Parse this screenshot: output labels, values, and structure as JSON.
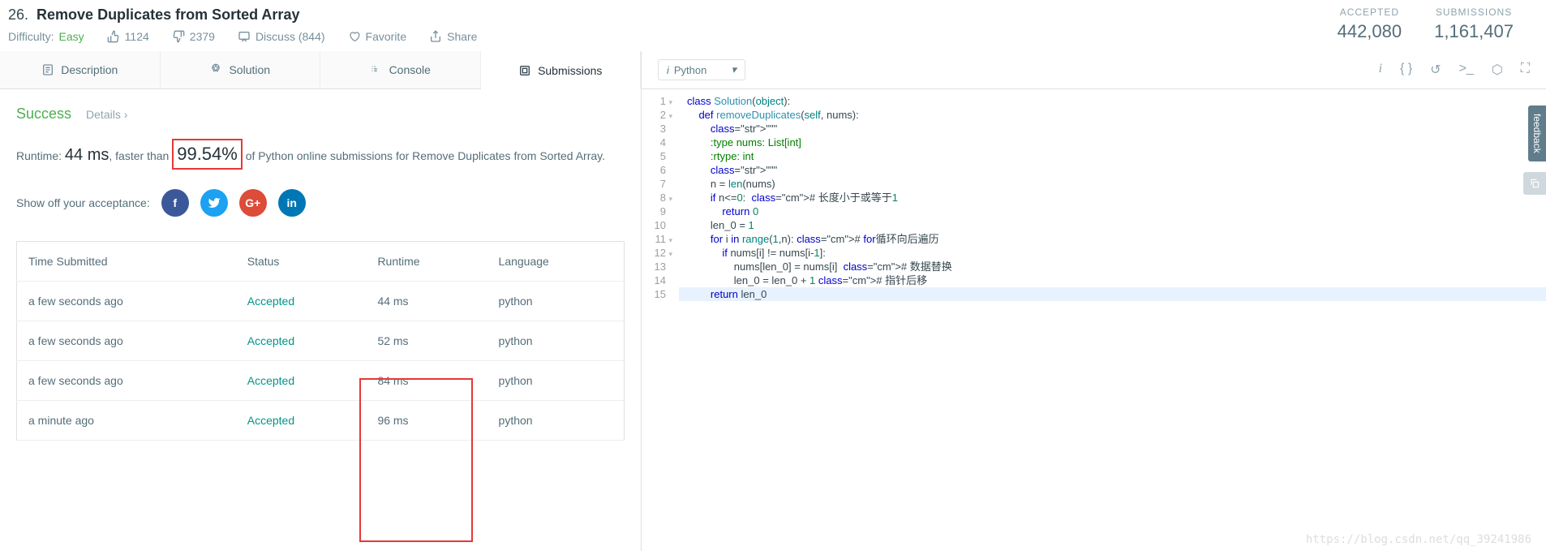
{
  "problem": {
    "number": "26.",
    "title": "Remove Duplicates from Sorted Array",
    "difficulty_label": "Difficulty:",
    "difficulty": "Easy",
    "likes": "1124",
    "dislikes": "2379",
    "discuss": "Discuss (844)",
    "favorite": "Favorite",
    "share": "Share"
  },
  "stats": {
    "accepted_label": "ACCEPTED",
    "accepted": "442,080",
    "submissions_label": "SUBMISSIONS",
    "submissions": "1,161,407"
  },
  "tabs": {
    "description": "Description",
    "solution": "Solution",
    "console": "Console",
    "submissions": "Submissions"
  },
  "language": "Python",
  "result": {
    "status": "Success",
    "details": "Details ›",
    "runtime_prefix": "Runtime: ",
    "runtime": "44 ms",
    "faster_than_prefix": ", faster than ",
    "percent": "99.54%",
    "suffix": " of Python online submissions for Remove Duplicates from Sorted Array.",
    "share_label": "Show off your acceptance:"
  },
  "table": {
    "headers": {
      "time": "Time Submitted",
      "status": "Status",
      "runtime": "Runtime",
      "lang": "Language"
    },
    "rows": [
      {
        "time": "a few seconds ago",
        "status": "Accepted",
        "runtime": "44 ms",
        "lang": "python"
      },
      {
        "time": "a few seconds ago",
        "status": "Accepted",
        "runtime": "52 ms",
        "lang": "python"
      },
      {
        "time": "a few seconds ago",
        "status": "Accepted",
        "runtime": "84 ms",
        "lang": "python"
      },
      {
        "time": "a minute ago",
        "status": "Accepted",
        "runtime": "96 ms",
        "lang": "python"
      }
    ]
  },
  "code": {
    "lines": [
      "class Solution(object):",
      "    def removeDuplicates(self, nums):",
      "        \"\"\"",
      "        :type nums: List[int]",
      "        :rtype: int",
      "        \"\"\"",
      "        n = len(nums)",
      "        if n<=0:  # 长度小于或等于1",
      "            return 0",
      "        len_0 = 1",
      "        for i in range(1,n): # for循环向后遍历",
      "            if nums[i] != nums[i-1]:",
      "                nums[len_0] = nums[i]  # 数据替换",
      "                len_0 = len_0 + 1 # 指针后移",
      "        return len_0"
    ]
  },
  "feedback": "feedback",
  "watermark": "https://blog.csdn.net/qq_39241986"
}
